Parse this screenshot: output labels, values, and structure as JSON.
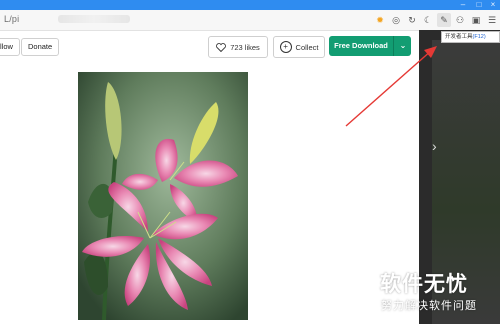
{
  "browser": {
    "address_prefix": "L/pi",
    "toolbar_icons": [
      "fire-icon",
      "camera-icon",
      "refresh-icon",
      "moon-icon",
      "devtools-icon",
      "user-icon",
      "frame-icon",
      "more-icon"
    ],
    "tooltip_text": "开发者工具",
    "tooltip_key": "(F12)"
  },
  "header": {
    "follow_label": "llow",
    "donate_label": "Donate",
    "likes_label": "723 likes",
    "collect_label": "Collect",
    "download_label": "Free Download"
  },
  "watermark": {
    "title": "软件无忧",
    "subtitle": "努力解决软件问题"
  },
  "colors": {
    "download_green": "#129d72",
    "annotation_arrow": "#e53935",
    "browser_blue": "#2f8cf0"
  }
}
